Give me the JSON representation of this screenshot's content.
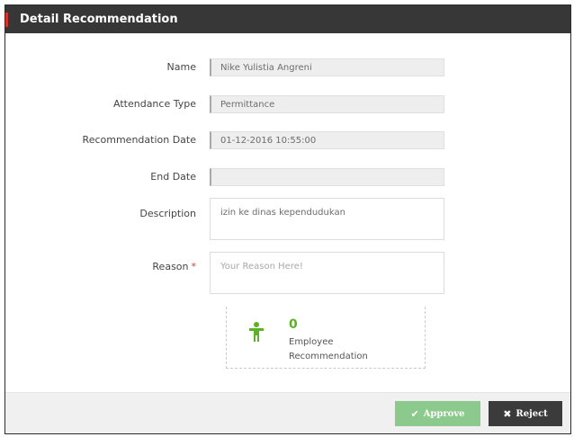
{
  "modal": {
    "title": "Detail Recommendation"
  },
  "form": {
    "name": {
      "label": "Name",
      "value": "Nike Yulistia Angreni"
    },
    "attendance_type": {
      "label": "Attendance Type",
      "value": "Permittance"
    },
    "recommendation_date": {
      "label": "Recommendation Date",
      "value": "01-12-2016 10:55:00"
    },
    "end_date": {
      "label": "End Date",
      "value": ""
    },
    "description": {
      "label": "Description",
      "value": "izin ke dinas kependudukan"
    },
    "reason": {
      "label": "Reason",
      "required_mark": "*",
      "value": "",
      "placeholder": "Your Reason Here!"
    }
  },
  "stat": {
    "icon": "person-icon",
    "value": "0",
    "label": "Employee Recommendation"
  },
  "footer": {
    "approve_label": "Approve",
    "approve_icon": "check-icon",
    "reject_label": "Reject",
    "reject_icon": "times-icon"
  },
  "colors": {
    "header_bg": "#373737",
    "header_accent": "#d9322b",
    "stat_green": "#5bb227",
    "approve_bg": "#8cc98c",
    "reject_bg": "#3b3b3b",
    "required_red": "#e53935"
  }
}
